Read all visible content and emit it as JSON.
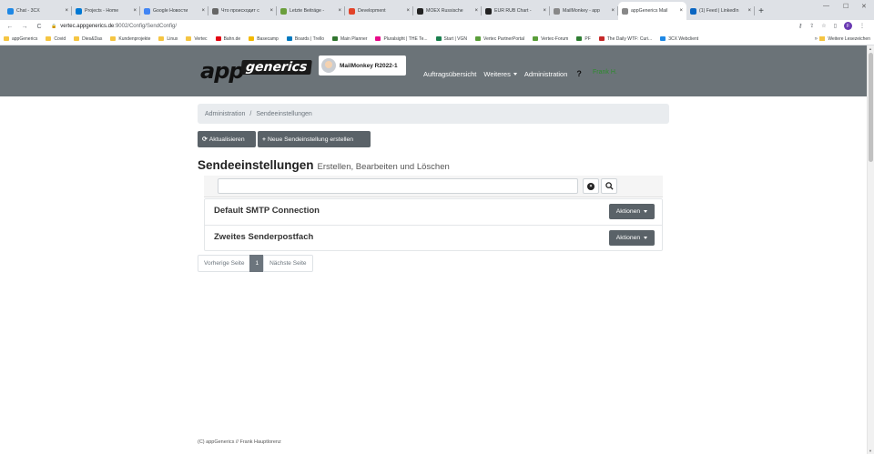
{
  "browser": {
    "tabs": [
      {
        "label": "Chat - 3CX",
        "color": "#1e88e5"
      },
      {
        "label": "Projects - Home",
        "color": "#0078d4"
      },
      {
        "label": "Google Новости",
        "color": "#4285f4"
      },
      {
        "label": "Что происходит с",
        "color": "#666666"
      },
      {
        "label": "Letzte Beiträge -",
        "color": "#6a9e3b"
      },
      {
        "label": "Development",
        "color": "#e24329"
      },
      {
        "label": "MOEX Russische",
        "color": "#222222"
      },
      {
        "label": "EUR RUB Chart -",
        "color": "#222222"
      },
      {
        "label": "MailMonkey - app",
        "color": "#888888"
      },
      {
        "label": "appGenerics Mail",
        "color": "#888888"
      },
      {
        "label": "(1) Feed | LinkedIn",
        "color": "#0a66c2"
      }
    ],
    "active_tab_index": 9,
    "url_host": "vertec.appgenerics.de",
    "url_path": ":9002/Config/SendConfig/",
    "profile_initial": "F",
    "bookmarks": [
      {
        "label": "appGenerics",
        "type": "folder",
        "color": "#f5c542"
      },
      {
        "label": "Covid",
        "type": "folder",
        "color": "#f5c542"
      },
      {
        "label": "Dies&Das",
        "type": "folder",
        "color": "#f5c542"
      },
      {
        "label": "Kundenprojekte",
        "type": "folder",
        "color": "#f5c542"
      },
      {
        "label": "Linux",
        "type": "folder",
        "color": "#f5c542"
      },
      {
        "label": "Vertec",
        "type": "folder",
        "color": "#f5c542"
      },
      {
        "label": "Bahn.de",
        "type": "link",
        "color": "#e30613"
      },
      {
        "label": "Basecamp",
        "type": "link",
        "color": "#f3b900"
      },
      {
        "label": "Boards | Trello",
        "type": "link",
        "color": "#0079bf"
      },
      {
        "label": "Main Planner",
        "type": "link",
        "color": "#31752f"
      },
      {
        "label": "Pluralsight | THE Te...",
        "type": "link",
        "color": "#e80a89"
      },
      {
        "label": "Start | VGN",
        "type": "link",
        "color": "#1a7f4e"
      },
      {
        "label": "Vertec PartnerPortal",
        "type": "link",
        "color": "#5a9e3a"
      },
      {
        "label": "Vertec-Forum",
        "type": "link",
        "color": "#5a9e3a"
      },
      {
        "label": "PF",
        "type": "link",
        "color": "#2e7d32"
      },
      {
        "label": "The Daily WTF: Curi...",
        "type": "link",
        "color": "#c62828"
      },
      {
        "label": "3CX Webclient",
        "type": "link",
        "color": "#1e88e5"
      }
    ],
    "bookmarks_more": "»",
    "other_bookmarks": "Weitere Lesezeichen"
  },
  "app": {
    "logo_app": "app",
    "logo_generics": "generics",
    "brand_name": "MailMonkey R2022-1",
    "nav": {
      "overview": "Auftragsübersicht",
      "more": "Weiteres",
      "admin": "Administration",
      "help": "?"
    },
    "user_link": "Frank H."
  },
  "breadcrumb": {
    "parent": "Administration",
    "separator": "/",
    "current": "Sendeeinstellungen"
  },
  "toolbar": {
    "refresh_label": "Aktualisieren",
    "new_label": "Neue Sendeinstellung erstellen"
  },
  "page": {
    "title": "Sendeeinstellungen",
    "subtitle": "Erstellen, Bearbeiten und Löschen"
  },
  "search": {
    "value": "",
    "placeholder": ""
  },
  "items": [
    {
      "name": "Default SMTP Connection",
      "action_label": "Aktionen"
    },
    {
      "name": "Zweites Senderpostfach",
      "action_label": "Aktionen"
    }
  ],
  "pager": {
    "prev": "Vorherige Seite",
    "current": "1",
    "next": "Nächste Seite"
  },
  "footer": {
    "text": "(C) appGenerics // Frank Hauptlorenz"
  }
}
